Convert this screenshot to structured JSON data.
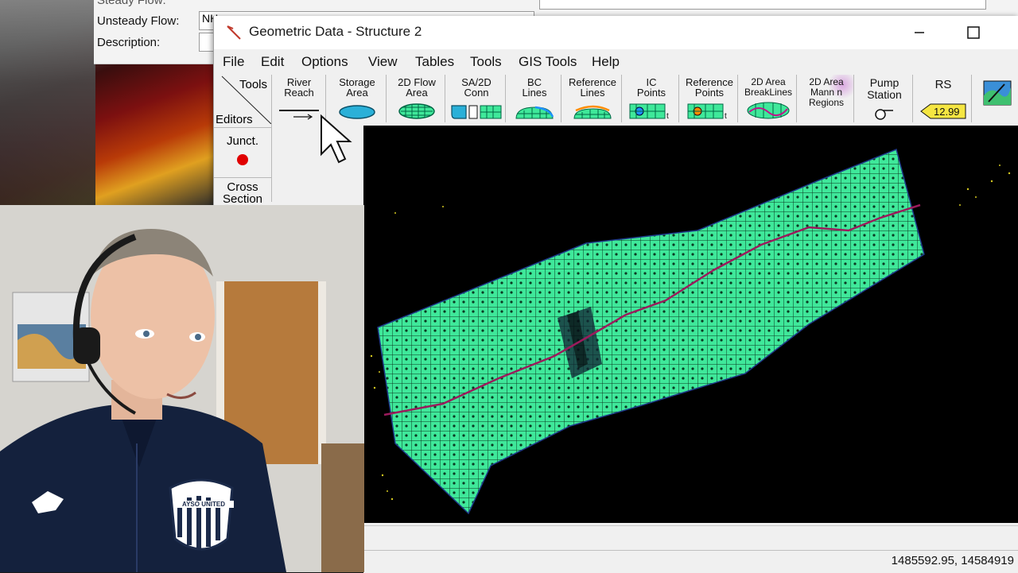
{
  "plan_window": {
    "steady_flow_label": "Steady Flow:",
    "unsteady_flow_label": "Unsteady Flow:",
    "unsteady_flow_value": "NH",
    "description_label": "Description:"
  },
  "window": {
    "title": "Geometric Data - Structure 2"
  },
  "menu": [
    "File",
    "Edit",
    "Options",
    "View",
    "Tables",
    "Tools",
    "GIS Tools",
    "Help"
  ],
  "toolbar": {
    "tools_label": "Tools",
    "editors_label": "Editors",
    "buttons": [
      {
        "label": "River\nReach",
        "icon": "river-reach-arrow-icon"
      },
      {
        "label": "Storage\nArea",
        "icon": "storage-area-icon"
      },
      {
        "label": "2D Flow\nArea",
        "icon": "2d-flow-area-icon"
      },
      {
        "label": "SA/2D\nConn",
        "icon": "sa-2d-connection-icon"
      },
      {
        "label": "BC\nLines",
        "icon": "bc-lines-icon"
      },
      {
        "label": "Reference\nLines",
        "icon": "reference-lines-icon"
      },
      {
        "label": "IC\nPoints",
        "icon": "ic-points-icon"
      },
      {
        "label": "Reference\nPoints",
        "icon": "reference-points-icon"
      },
      {
        "label": "2D Area\nBreakLines",
        "icon": "breaklines-icon"
      },
      {
        "label": "2D Area\nMann n\nRegions",
        "icon": "mannings-regions-icon"
      },
      {
        "label": "Pump\nStation",
        "icon": "pump-station-icon"
      },
      {
        "label": "RS",
        "icon": "river-station-tag-icon",
        "tag_value": "12.99"
      },
      {
        "label": "",
        "icon": "map-layers-icon"
      }
    ]
  },
  "editors": {
    "junction_label": "Junct.",
    "cross_section_label": "Cross\nSection"
  },
  "status": {
    "coordinates": "1485592.95, 14584919"
  },
  "colors": {
    "mesh_fill": "#3fe89a",
    "centerline": "#9b1b5c",
    "canvas_bg": "#000000",
    "junction_dot": "#e00000"
  },
  "webcam": {
    "shirt_text": "AYSO UNITED"
  }
}
